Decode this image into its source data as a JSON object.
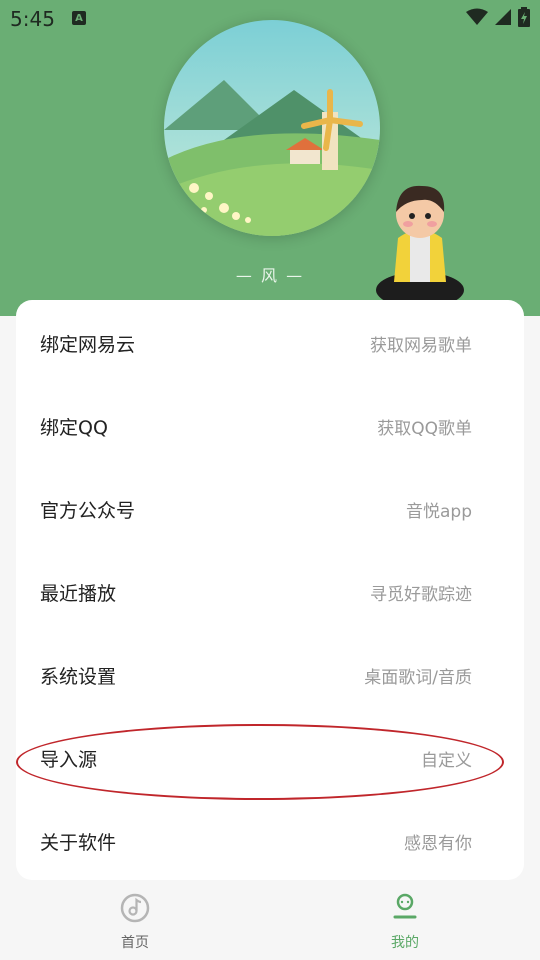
{
  "status_bar": {
    "time": "5:45",
    "notification_glyph": "A",
    "icons": [
      "wifi-icon",
      "signal-icon",
      "battery-charging-icon"
    ]
  },
  "header": {
    "caption": "— 风 —",
    "cover_icon": "windmill-landscape-illustration",
    "avatar_icon": "sitting-character-avatar"
  },
  "menu": [
    {
      "title": "绑定网易云",
      "subtitle": "获取网易歌单"
    },
    {
      "title": "绑定QQ",
      "subtitle": "获取QQ歌单"
    },
    {
      "title": "官方公众号",
      "subtitle": "音悦app"
    },
    {
      "title": "最近播放",
      "subtitle": "寻觅好歌踪迹"
    },
    {
      "title": "系统设置",
      "subtitle": "桌面歌词/音质"
    },
    {
      "title": "导入源",
      "subtitle": "自定义"
    },
    {
      "title": "关于软件",
      "subtitle": "感恩有你"
    }
  ],
  "bottom_nav": {
    "tabs": [
      {
        "label": "首页",
        "icon": "music-disc-icon",
        "active": false
      },
      {
        "label": "我的",
        "icon": "profile-icon",
        "active": true
      }
    ]
  },
  "colors": {
    "header_green": "#6aae74",
    "active_tab": "#5aa866",
    "highlight_ring": "#c0262b"
  }
}
